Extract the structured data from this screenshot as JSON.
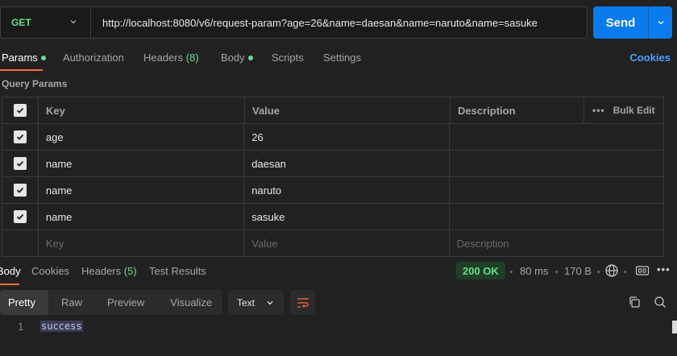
{
  "request": {
    "method": "GET",
    "url": "http://localhost:8080/v6/request-param?age=26&name=daesan&name=naruto&name=sasuke",
    "send_label": "Send"
  },
  "tabs": {
    "params": "Params",
    "authorization": "Authorization",
    "headers": "Headers",
    "headers_count": "(8)",
    "body": "Body",
    "scripts": "Scripts",
    "settings": "Settings",
    "cookies": "Cookies"
  },
  "query_params": {
    "title": "Query Params",
    "headers": {
      "key": "Key",
      "value": "Value",
      "description": "Description",
      "bulk_edit": "Bulk Edit"
    },
    "rows": [
      {
        "key": "age",
        "value": "26",
        "description": "",
        "checked": true
      },
      {
        "key": "name",
        "value": "daesan",
        "description": "",
        "checked": true
      },
      {
        "key": "name",
        "value": "naruto",
        "description": "",
        "checked": true
      },
      {
        "key": "name",
        "value": "sasuke",
        "description": "",
        "checked": true
      }
    ],
    "placeholders": {
      "key": "Key",
      "value": "Value",
      "description": "Description"
    }
  },
  "response": {
    "tabs": {
      "body": "Body",
      "cookies": "Cookies",
      "headers": "Headers",
      "headers_count": "(5)",
      "test_results": "Test Results"
    },
    "status": "200 OK",
    "time": "80 ms",
    "size": "170 B",
    "format_tabs": [
      "Pretty",
      "Raw",
      "Preview",
      "Visualize"
    ],
    "format_type": "Text",
    "lines": [
      {
        "num": "1",
        "text": "success"
      }
    ]
  },
  "colors": {
    "accent_orange": "#ff6c37",
    "send_blue": "#097bed",
    "status_green": "#6bdd8b",
    "link_blue": "#4a9fff"
  }
}
